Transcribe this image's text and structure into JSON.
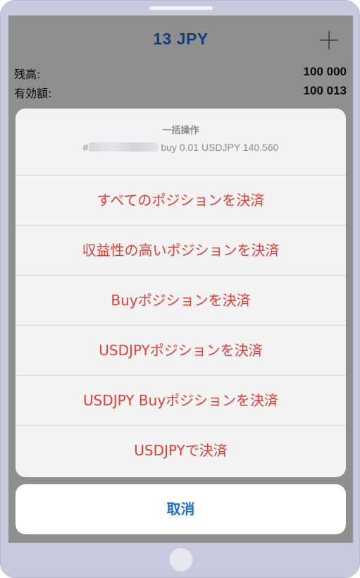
{
  "header": {
    "title": "13 JPY",
    "add_icon": "plus-icon"
  },
  "account": [
    {
      "label": "残高:",
      "value": "100 000"
    },
    {
      "label": "有効額:",
      "value": "100 013"
    }
  ],
  "action_sheet": {
    "title": "一括操作",
    "message_prefix": "#",
    "message_suffix": "buy 0.01 USDJPY 140.560",
    "actions": [
      "すべてのポジションを決済",
      "収益性の高いポジションを決済",
      "Buyポジションを決済",
      "USDJPYポジションを決済",
      "USDJPY Buyポジションを決済",
      "USDJPYで決済"
    ],
    "cancel": "取消"
  },
  "colors": {
    "accent": "#1a6fd6",
    "destructive": "#ea3b32",
    "device_frame": "#c9c8dc"
  }
}
